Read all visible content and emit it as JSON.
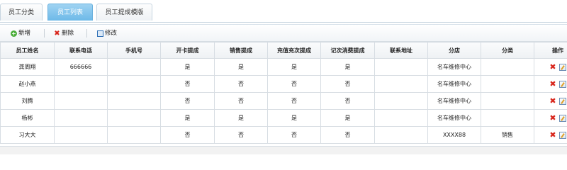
{
  "tabs": [
    {
      "label": "员工分类",
      "active": false
    },
    {
      "label": "员工列表",
      "active": true
    },
    {
      "label": "员工提成模版",
      "active": false
    }
  ],
  "toolbar": {
    "add_label": "新增",
    "delete_label": "删除",
    "edit_label": "修改",
    "add_icon": "plus-circle-icon",
    "delete_icon": "x-icon",
    "edit_icon": "edit-icon"
  },
  "table": {
    "columns": [
      "员工姓名",
      "联系电话",
      "手机号",
      "开卡提成",
      "销售提成",
      "充值充次提成",
      "记次消费提成",
      "联系地址",
      "分店",
      "分类",
      "操作"
    ],
    "rows": [
      [
        "龚周翔",
        "666666",
        "",
        "是",
        "是",
        "是",
        "是",
        "",
        "名车维修中心",
        "",
        ""
      ],
      [
        "赵小燕",
        "",
        "",
        "否",
        "否",
        "否",
        "否",
        "",
        "名车维修中心",
        "",
        ""
      ],
      [
        "刘腾",
        "",
        "",
        "否",
        "否",
        "否",
        "否",
        "",
        "名车维修中心",
        "",
        ""
      ],
      [
        "杨彬",
        "",
        "",
        "是",
        "是",
        "是",
        "是",
        "",
        "名车维修中心",
        "",
        ""
      ],
      [
        "习大大",
        "",
        "",
        "否",
        "否",
        "否",
        "否",
        "",
        "XXXX88",
        "销售",
        ""
      ]
    ]
  },
  "colors": {
    "active_tab": "#6db9e8",
    "delete_red": "#d8261c",
    "add_green": "#4caf3c"
  }
}
